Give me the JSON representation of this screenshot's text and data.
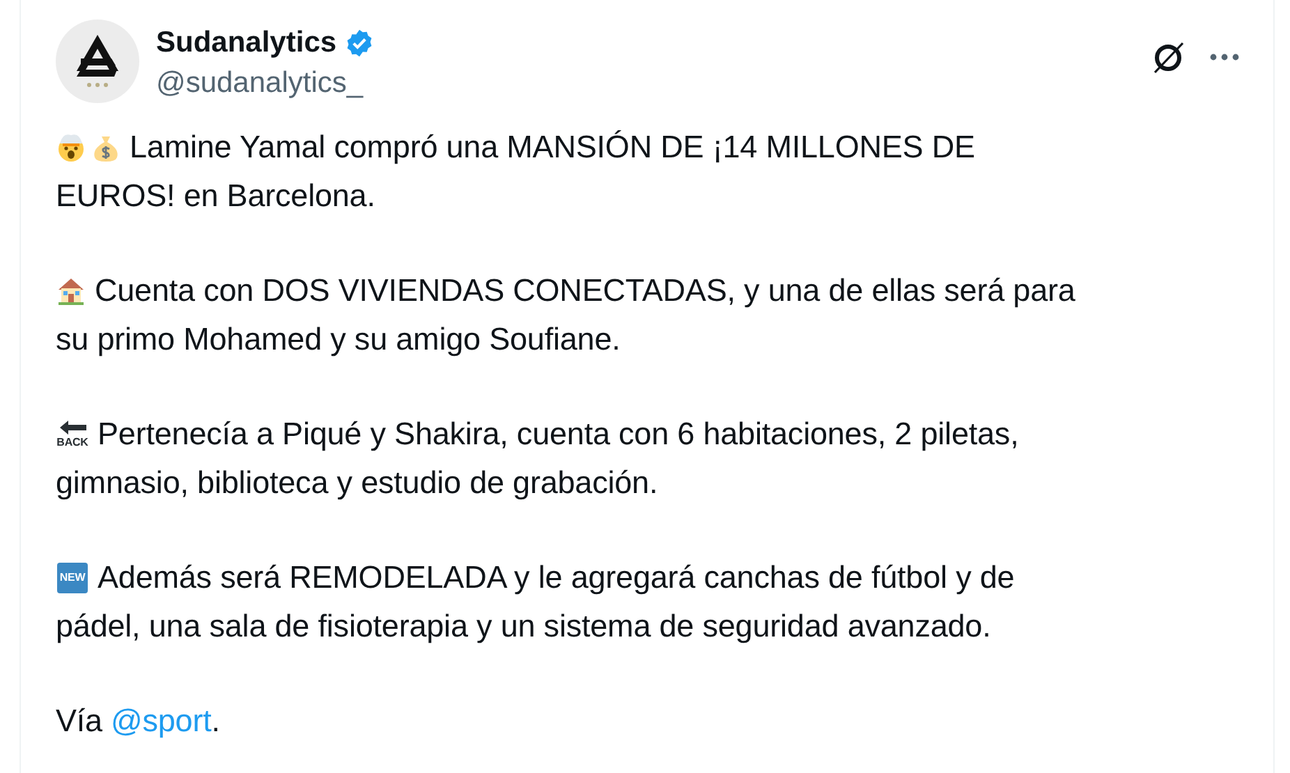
{
  "author": {
    "name": "Sudanalytics",
    "verified": true,
    "handle": "@sudanalytics_"
  },
  "paragraphs": [
    {
      "emoji": [
        {
          "kind": "exploding-head"
        },
        {
          "kind": "money-bag"
        }
      ],
      "lines": [
        "Lamine Yamal compró una MANSIÓN DE ¡14 MILLONES DE",
        "EUROS! en Barcelona."
      ]
    },
    {
      "emoji": [
        {
          "kind": "house"
        }
      ],
      "lines": [
        "Cuenta con DOS VIVIENDAS CONECTADAS, y una de ellas será para",
        "su primo Mohamed y su amigo Soufiane."
      ]
    },
    {
      "emoji": [
        {
          "kind": "back",
          "label": "BACK"
        }
      ],
      "lines": [
        "Pertenecía a Piqué y Shakira, cuenta con 6 habitaciones, 2 piletas,",
        "gimnasio, biblioteca y estudio de grabación."
      ]
    },
    {
      "emoji": [
        {
          "kind": "new",
          "label": "NEW"
        }
      ],
      "lines": [
        "Además será REMODELADA y le agregará canchas de fútbol y de",
        "pádel, una sala de fisioterapia y un sistema de seguridad avanzado."
      ]
    },
    {
      "lines": [
        "Vía"
      ],
      "link": "@sport",
      "after": "."
    }
  ]
}
